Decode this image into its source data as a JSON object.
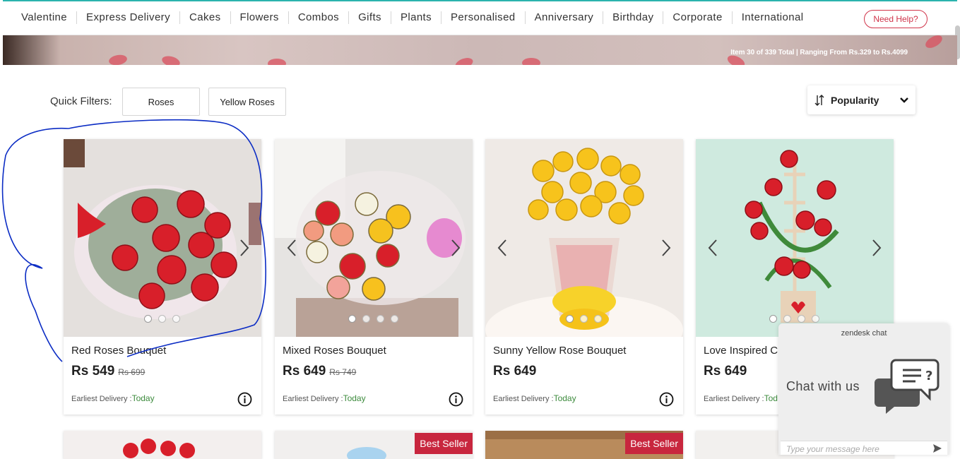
{
  "nav": {
    "items": [
      "Valentine",
      "Express Delivery",
      "Cakes",
      "Flowers",
      "Combos",
      "Gifts",
      "Plants",
      "Personalised",
      "Anniversary",
      "Birthday",
      "Corporate",
      "International"
    ],
    "help_label": "Need Help?"
  },
  "banner": {
    "summary": "Item 30 of 339 Total | Ranging From Rs.329 to Rs.4099"
  },
  "quick_filters": {
    "label": "Quick Filters:",
    "items": [
      "Roses",
      "Yellow Roses"
    ]
  },
  "sort": {
    "selected": "Popularity",
    "icon": "sort-arrows-icon"
  },
  "products": [
    {
      "name": "Red Roses Bouquet",
      "price": "Rs 549",
      "old_price": "Rs 699",
      "delivery_label": "Earliest Delivery :",
      "delivery_value": "Today"
    },
    {
      "name": "Mixed Roses Bouquet",
      "price": "Rs 649",
      "old_price": "Rs 749",
      "delivery_label": "Earliest Delivery :",
      "delivery_value": "Today"
    },
    {
      "name": "Sunny Yellow Rose Bouquet",
      "price": "Rs 649",
      "old_price": "",
      "delivery_label": "Earliest Delivery :",
      "delivery_value": "Today"
    },
    {
      "name": "Love Inspired C",
      "price": "Rs 649",
      "old_price": "",
      "delivery_label": "Earliest Delivery :",
      "delivery_value": "Tod"
    }
  ],
  "badges": {
    "best_seller": "Best Seller"
  },
  "chat": {
    "brand": "zendesk chat",
    "title": "Chat with us",
    "placeholder": "Type your message here"
  },
  "colors": {
    "accent": "#2bb3ad",
    "brand_red": "#c8263e",
    "delivery_green": "#3d8b3d"
  }
}
